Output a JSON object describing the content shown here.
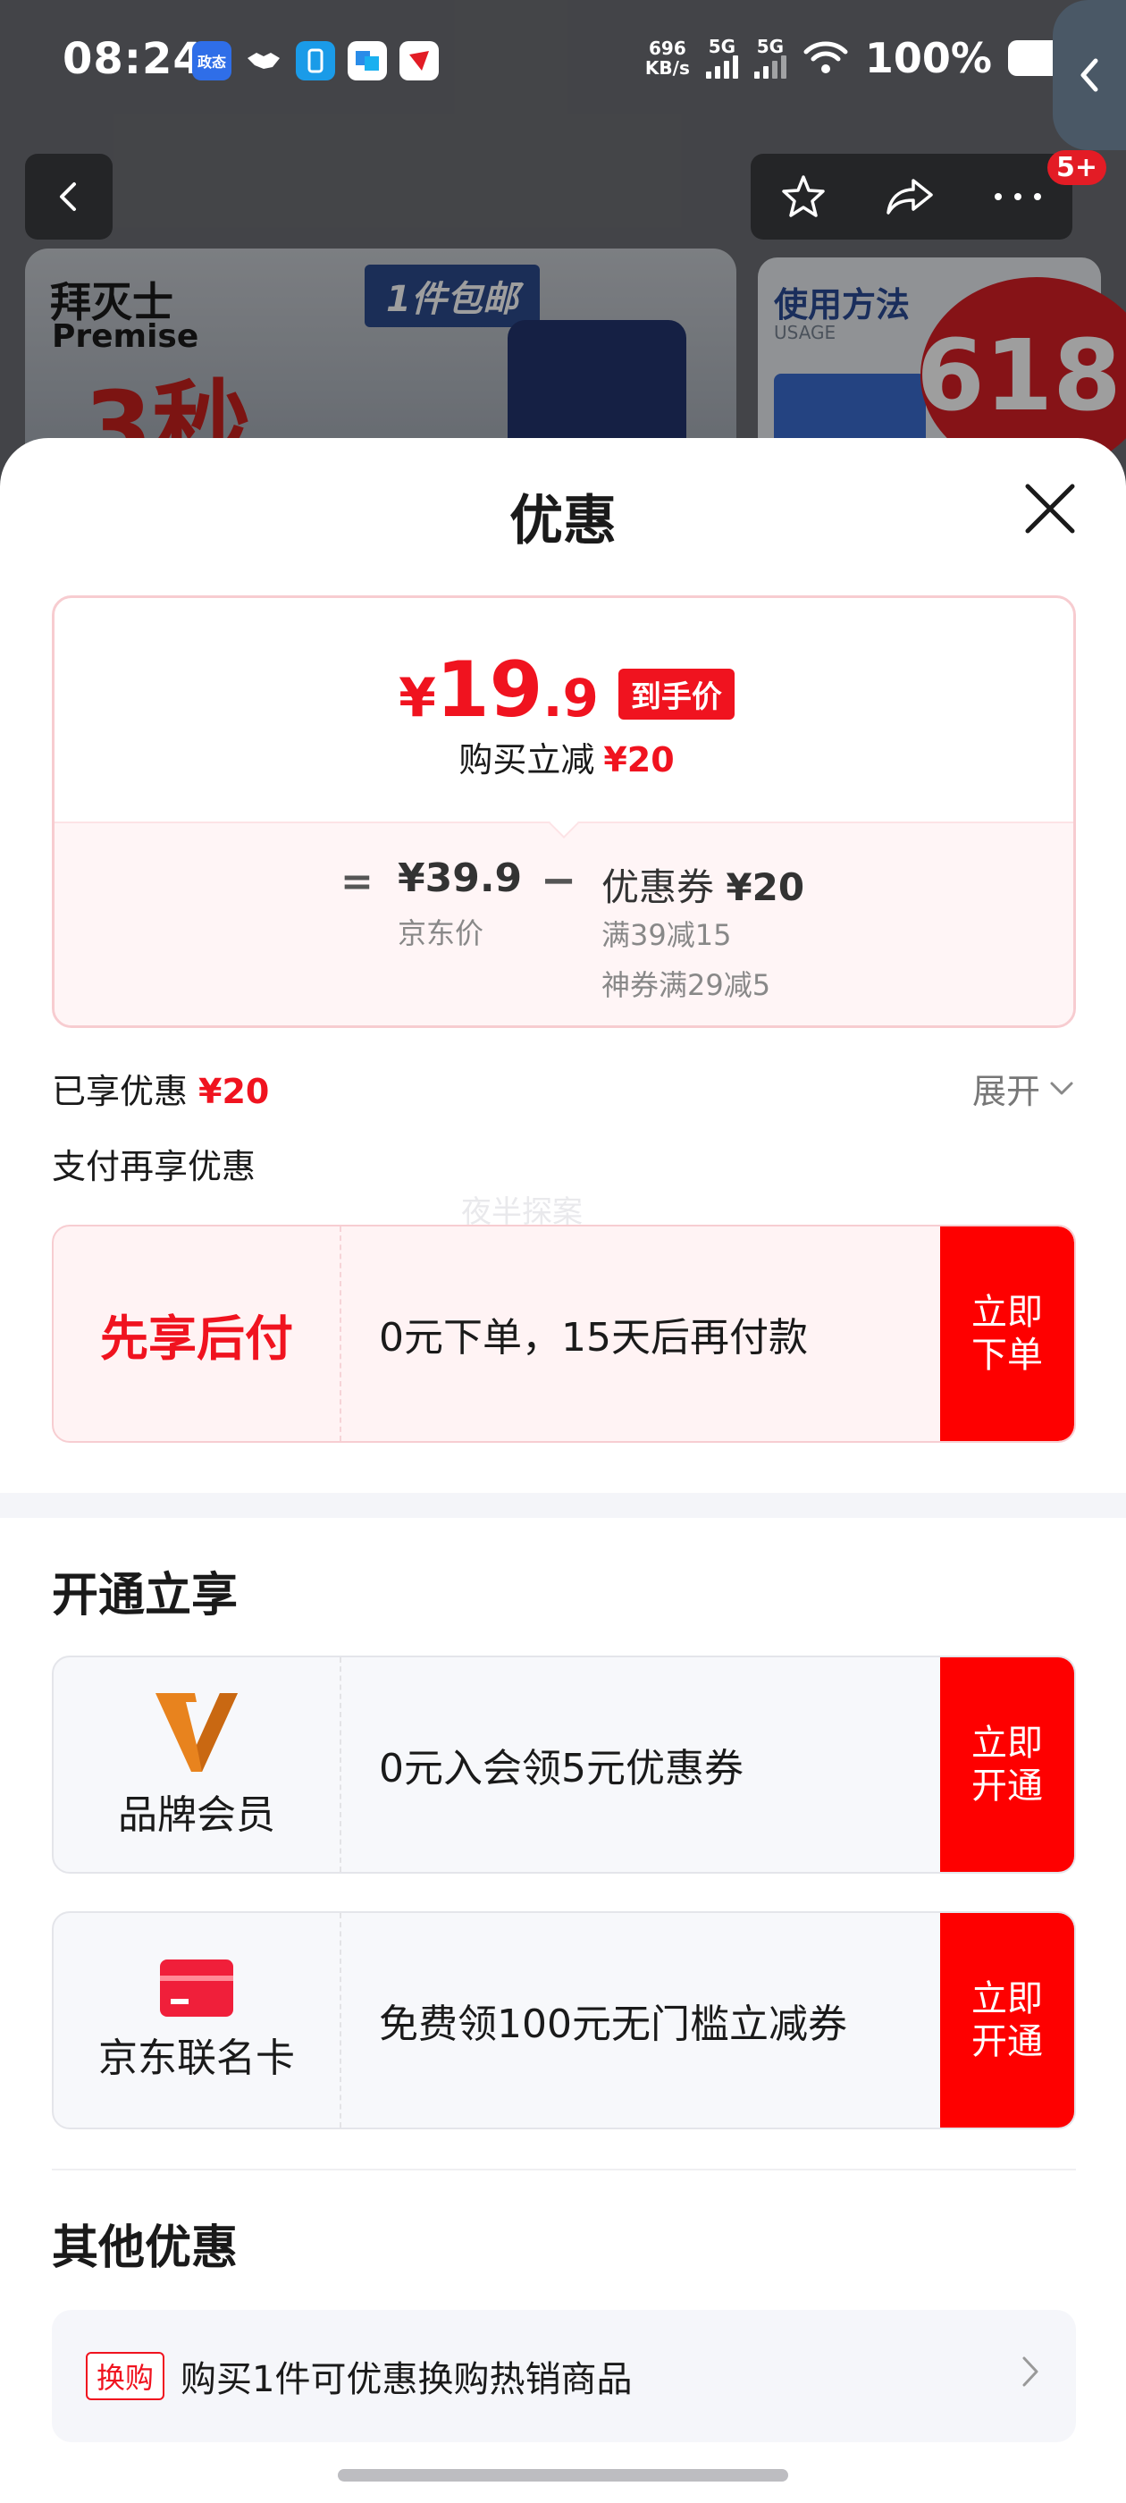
{
  "status_bar": {
    "time": "08:24",
    "net_speed_value": "696",
    "net_speed_unit": "KB/s",
    "sim1": "5G",
    "sim2": "5G",
    "battery": "100%",
    "app_label": "政态"
  },
  "background": {
    "brand_cn": "拜灭士",
    "brand_en": "Premise",
    "big_text": "3秒",
    "shipping": "1件包邮",
    "usage_title": "使用方法",
    "usage_sub": "USAGE",
    "promo_badge": "618",
    "cart_badge": "5+"
  },
  "sheet": {
    "title": "优惠",
    "price_card": {
      "currency": "¥",
      "price_int": "19",
      "price_dec": ".9",
      "final_tag": "到手价",
      "save_label": "购买立减",
      "save_amount": "¥20",
      "equals": "=",
      "jd_price": "¥39.9",
      "jd_label": "京东价",
      "minus": "−",
      "coupon_label": "优惠券",
      "coupon_amount": "¥20",
      "coupon_rule1": "满39减15",
      "coupon_rule2": "神券满29减5"
    },
    "enjoyed_label": "已享优惠",
    "enjoyed_amount": "¥20",
    "expand_label": "展开",
    "pay_more_label": "支付再享优惠",
    "watermark": "夜半探案",
    "pay_later": {
      "title": "先享后付",
      "desc": "0元下单，15天后再付款",
      "button": "立即下单"
    },
    "open_section_title": "开通立享",
    "member": {
      "title": "品牌会员",
      "desc": "0元入会领5元优惠券",
      "button": "立即开通"
    },
    "credit_card": {
      "title": "京东联名卡",
      "desc": "免费领100元无门槛立减券",
      "button": "立即开通"
    },
    "other_section_title": "其他优惠",
    "exchange": {
      "tag": "换购",
      "text": "购买1件可优惠换购热销商品"
    }
  },
  "colors": {
    "accent_red": "#f0131f",
    "button_red": "#fe0000",
    "member_orange": "#e8831e"
  }
}
